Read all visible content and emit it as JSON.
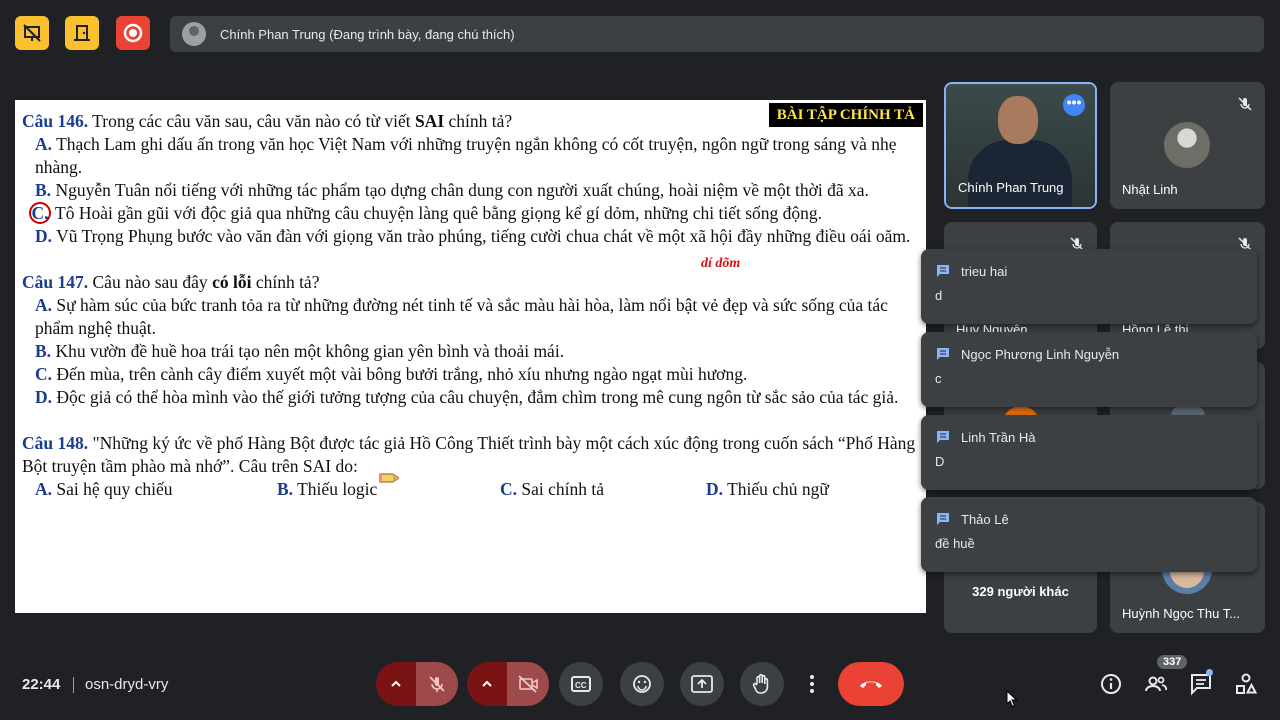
{
  "top": {
    "presenter": "Chính Phan Trung (Đang trình bày, đang chú thích)"
  },
  "slide": {
    "tag": "BÀI TẬP CHÍNH TẢ",
    "q146": {
      "num": "Câu 146.",
      "text_pre": " Trong các câu văn sau, câu văn nào có từ viết ",
      "text_bold": "SAI",
      "text_post": " chính tả?",
      "a_letter": "A.",
      "a_text": " Thạch Lam ghi dấu ấn trong văn học Việt Nam với những truyện ngắn không có cốt truyện, ngôn ngữ trong sáng và nhẹ nhàng.",
      "b_letter": "B.",
      "b_text": " Nguyễn Tuân nổi tiếng với những tác phẩm tạo dựng chân dung con người xuất chúng, hoài niệm về một thời đã xa.",
      "c_letter": "C.",
      "c_text": " Tô Hoài gần gũi với độc giả qua những câu chuyện làng quê bằng giọng kể gí dỏm, những chi tiết sống động.",
      "d_letter": "D.",
      "d_text": " Vũ Trọng Phụng bước vào văn đàn với giọng văn trào phúng, tiếng cười chua chát về một xã hội đầy những điều oái oăm.",
      "annotation": "dí dõm"
    },
    "q147": {
      "num": "Câu 147.",
      "text_pre": " Câu nào sau đây ",
      "text_bold": "có lỗi",
      "text_post": " chính tả?",
      "a_letter": "A.",
      "a_text": " Sự hàm súc của bức tranh tỏa ra từ những đường nét tinh tế và sắc màu hài hòa, làm nổi bật vẻ đẹp và sức sống của tác phẩm nghệ thuật.",
      "b_letter": "B.",
      "b_text": " Khu vườn đề huề hoa trái tạo nên một không gian yên bình và thoải mái.",
      "c_letter": "C.",
      "c_text": " Đến mùa, trên cành cây điểm xuyết một vài bông bưởi trắng, nhỏ xíu nhưng ngào ngạt mùi hương.",
      "d_letter": "D.",
      "d_text": " Độc giả có thể hòa mình vào thế giới tưởng tượng của câu chuyện, đắm chìm trong mê cung ngôn từ sắc sảo của tác giả."
    },
    "q148": {
      "num": "Câu 148.",
      "text": " \"Những ký ức về phố Hàng Bột được tác giả Hồ Công Thiết trình bày một cách xúc động trong cuốn sách “Phố Hàng Bột truyện tầm phào mà nhớ”. Câu trên SAI do:",
      "a_letter": "A.",
      "a_text": " Sai hệ quy chiếu",
      "b_letter": "B.",
      "b_text": " Thiếu logic",
      "c_letter": "C.",
      "c_text": " Sai chính tả",
      "d_letter": "D.",
      "d_text": " Thiếu chủ ngữ"
    }
  },
  "participants": {
    "p1": "Chính Phan Trung",
    "p2": "Nhật Linh",
    "p3": "Huy Nguyễn",
    "p4": "Hồng Lê thị",
    "others": "329 người khác",
    "p8": "Huỳnh Ngọc Thu T..."
  },
  "chat": [
    {
      "name": "trieu hai",
      "msg": "d"
    },
    {
      "name": "Ngọc Phương Linh Nguyễn",
      "msg": "c"
    },
    {
      "name": "Linh Trần Hà",
      "msg": "D"
    },
    {
      "name": "Thảo Lê",
      "msg": "đề huề"
    }
  ],
  "bottom": {
    "time": "22:44",
    "code": "osn-dryd-vry",
    "people_count": "337"
  }
}
